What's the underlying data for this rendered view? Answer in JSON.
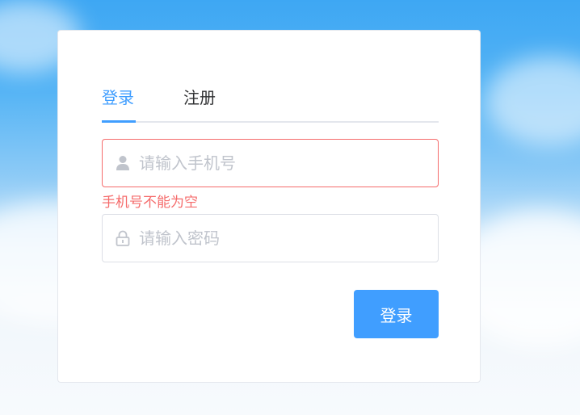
{
  "tabs": [
    {
      "label": "登录",
      "active": true
    },
    {
      "label": "注册",
      "active": false
    }
  ],
  "phone": {
    "placeholder": "请输入手机号",
    "value": "",
    "icon": "user-icon",
    "error": "手机号不能为空"
  },
  "password": {
    "placeholder": "请输入密码",
    "value": "",
    "icon": "lock-icon"
  },
  "submit_label": "登录",
  "colors": {
    "primary": "#409eff",
    "error": "#f56c6c",
    "placeholder": "#c0c4cc"
  }
}
